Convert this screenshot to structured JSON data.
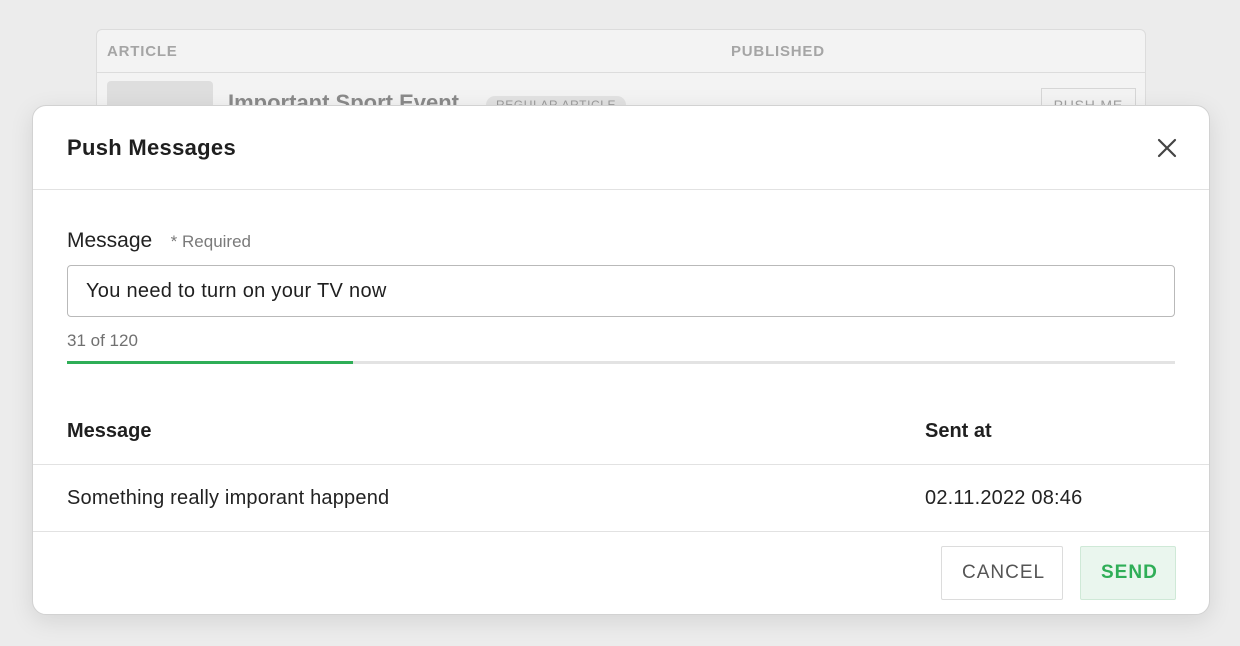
{
  "background": {
    "table": {
      "columns": [
        "ARTICLE",
        "PUBLISHED"
      ],
      "row": {
        "title": "Important Sport Event",
        "badge": "REGULAR ARTICLE",
        "action": "PUSH ME"
      }
    }
  },
  "modal": {
    "title": "Push Messages",
    "close_icon": "close-icon",
    "field": {
      "label": "Message",
      "required": "* Required",
      "value": "You need to turn on your TV now",
      "char_count_text": "31 of 120",
      "progress_fraction": 0.2583
    },
    "table": {
      "headers": [
        "Message",
        "Sent at"
      ],
      "rows": [
        {
          "message": "Something really imporant happend",
          "sent_at": "02.11.2022 08:46"
        }
      ]
    },
    "buttons": {
      "cancel": "CANCEL",
      "send": "SEND"
    }
  },
  "colors": {
    "accent": "#2fae57",
    "send_bg": "#eaf6ee"
  }
}
